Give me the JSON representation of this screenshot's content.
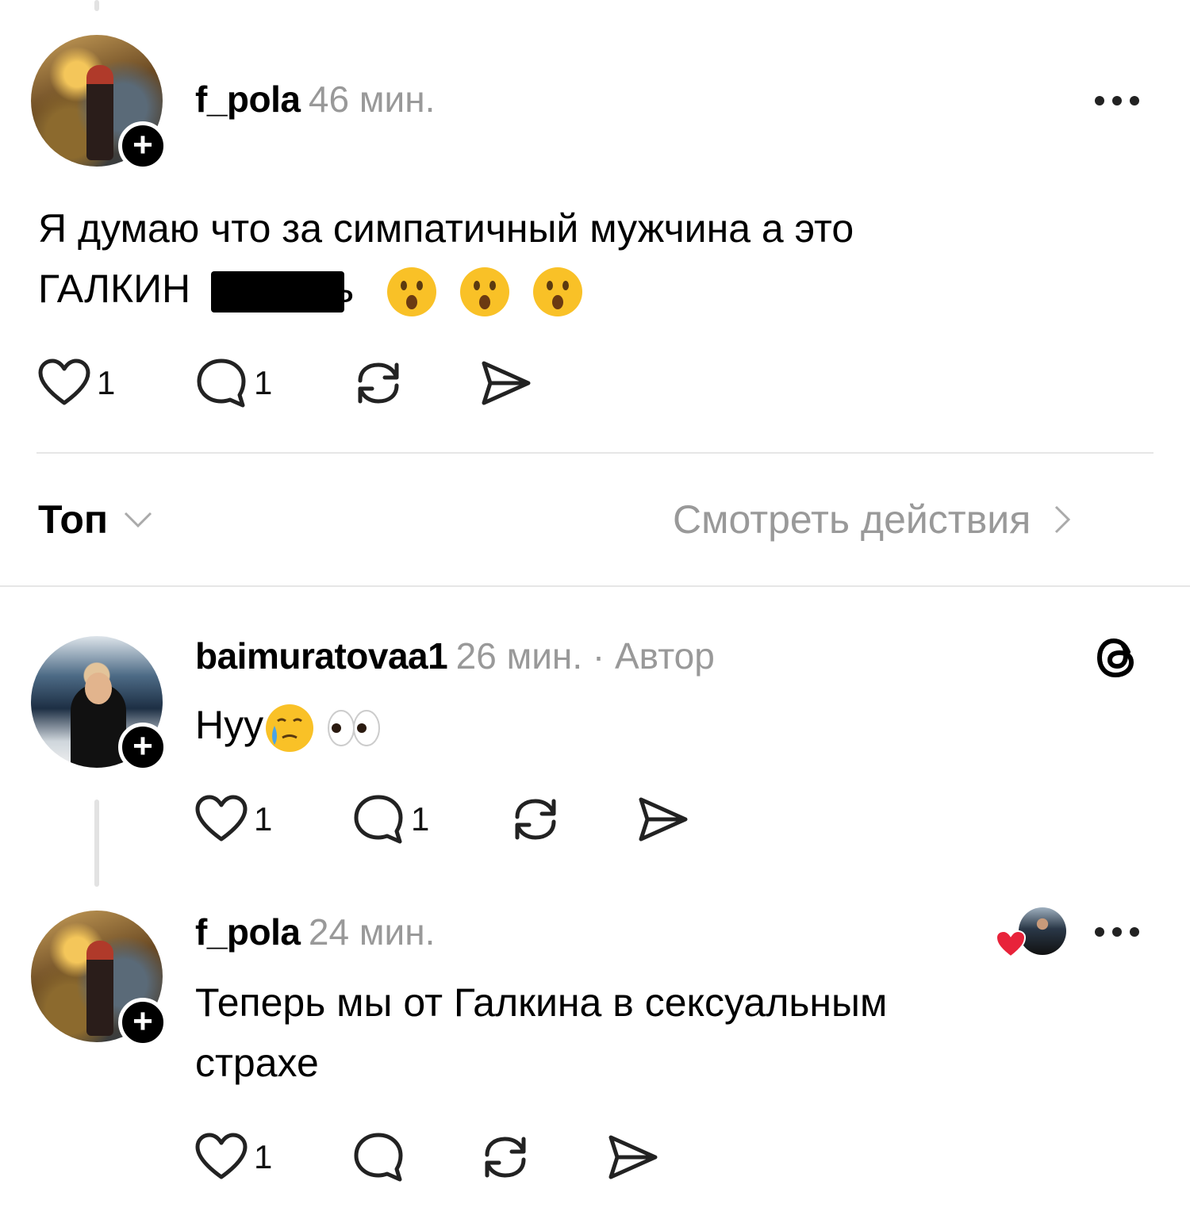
{
  "post": {
    "username": "f_pola",
    "time": "46 мин.",
    "text_line1": "Я думаю что за симпатичный мужчина а это",
    "text_line2_prefix": "ГАЛКИН",
    "text_line2_tail": "ь",
    "likes": "1",
    "comments": "1"
  },
  "sort": {
    "label": "Топ",
    "activity_link": "Смотреть действия"
  },
  "reply1": {
    "username": "baimuratovaa1",
    "meta": "26 мин. · Автор",
    "text": "Нуу",
    "likes": "1",
    "comments": "1"
  },
  "reply2": {
    "username": "f_pola",
    "time": "24 мин.",
    "text_line1": "Теперь мы от Галкина в сексуальным",
    "text_line2": "страхе",
    "likes": "1"
  },
  "icons": {
    "like": "heart-icon",
    "comment": "comment-bubble-icon",
    "repost": "repost-icon",
    "share": "send-icon",
    "more": "more-dots-icon",
    "threads": "threads-logo-icon",
    "follow": "plus-icon",
    "sort_chevron": "chevron-down-icon",
    "activity_chevron": "chevron-right-icon"
  },
  "colors": {
    "muted_text": "#999999",
    "divider": "#e6e6e6",
    "liked_heart": "#e8233a"
  }
}
